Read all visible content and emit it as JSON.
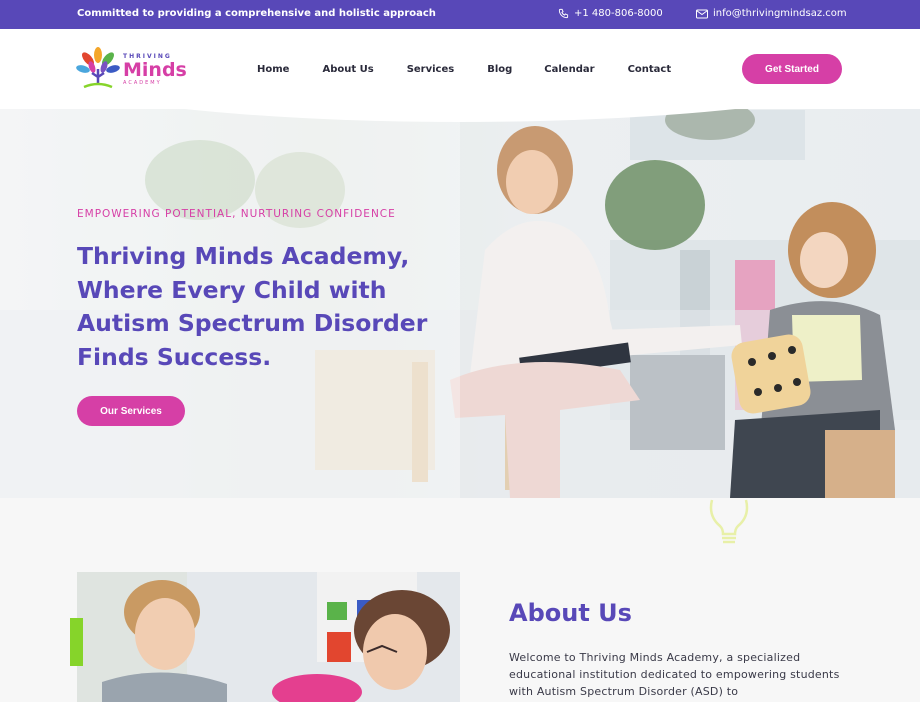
{
  "topbar": {
    "tagline": "Committed to providing a comprehensive and holistic approach",
    "phone": "+1 480-806-8000",
    "email": "info@thrivingmindsaz.com"
  },
  "logo": {
    "line1": "THRIVING",
    "line2": "Minds",
    "line3": "ACADEMY"
  },
  "nav": {
    "items": [
      {
        "label": "Home"
      },
      {
        "label": "About Us"
      },
      {
        "label": "Services"
      },
      {
        "label": "Blog"
      },
      {
        "label": "Calendar"
      },
      {
        "label": "Contact"
      }
    ],
    "cta_label": "Get Started"
  },
  "hero": {
    "eyebrow": "EMPOWERING POTENTIAL, NURTURING CONFIDENCE",
    "title": "Thriving Minds Academy, Where Every Child with Autism Spectrum Disorder Finds Success.",
    "button_label": "Our Services"
  },
  "about": {
    "title": "About Us",
    "text": "Welcome to Thriving Minds Academy, a specialized educational institution dedicated to empowering students with Autism Spectrum Disorder (ASD) to"
  },
  "colors": {
    "brand_purple": "#5848b8",
    "brand_pink": "#d63fa6",
    "accent_green": "#86d42a"
  },
  "icons": {
    "phone": "phone-icon",
    "email": "mail-icon",
    "decor": "lightbulb-icon"
  }
}
